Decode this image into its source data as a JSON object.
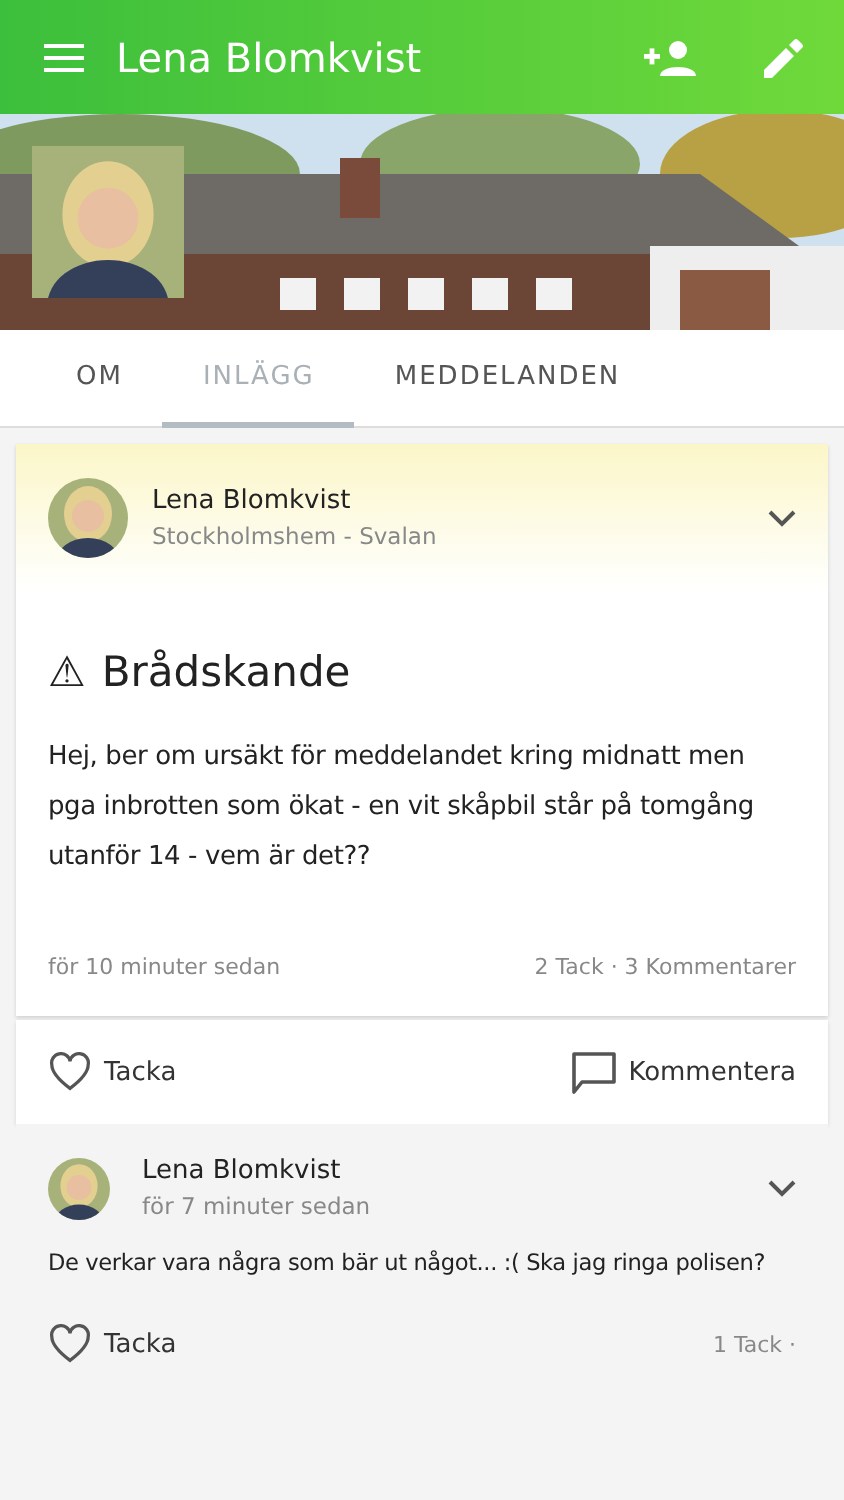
{
  "app_bar": {
    "title": "Lena Blomkvist"
  },
  "tabs": [
    {
      "label": "OM",
      "selected": false
    },
    {
      "label": "INLÄGG",
      "selected": true
    },
    {
      "label": "MEDDELANDEN",
      "selected": false
    }
  ],
  "post": {
    "author": "Lena Blomkvist",
    "group": "Stockholmshem - Svalan",
    "warning_icon": "⚠",
    "title": "Brådskande",
    "body": "Hej, ber om ursäkt för meddelandet kring midnatt men pga inbrotten som ökat - en vit skåpbil står på tomgång utanför 14 - vem är det??",
    "time": "för 10 minuter sedan",
    "stats": "2 Tack · 3 Kommentarer",
    "actions": {
      "thank": "Tacka",
      "comment": "Kommentera"
    }
  },
  "comments": [
    {
      "author": "Lena Blomkvist",
      "time": "för 7 minuter sedan",
      "body": "De verkar vara några som bär ut något... :( Ska jag ringa polisen?",
      "thank": "Tacka",
      "stats": "1 Tack ·"
    }
  ]
}
